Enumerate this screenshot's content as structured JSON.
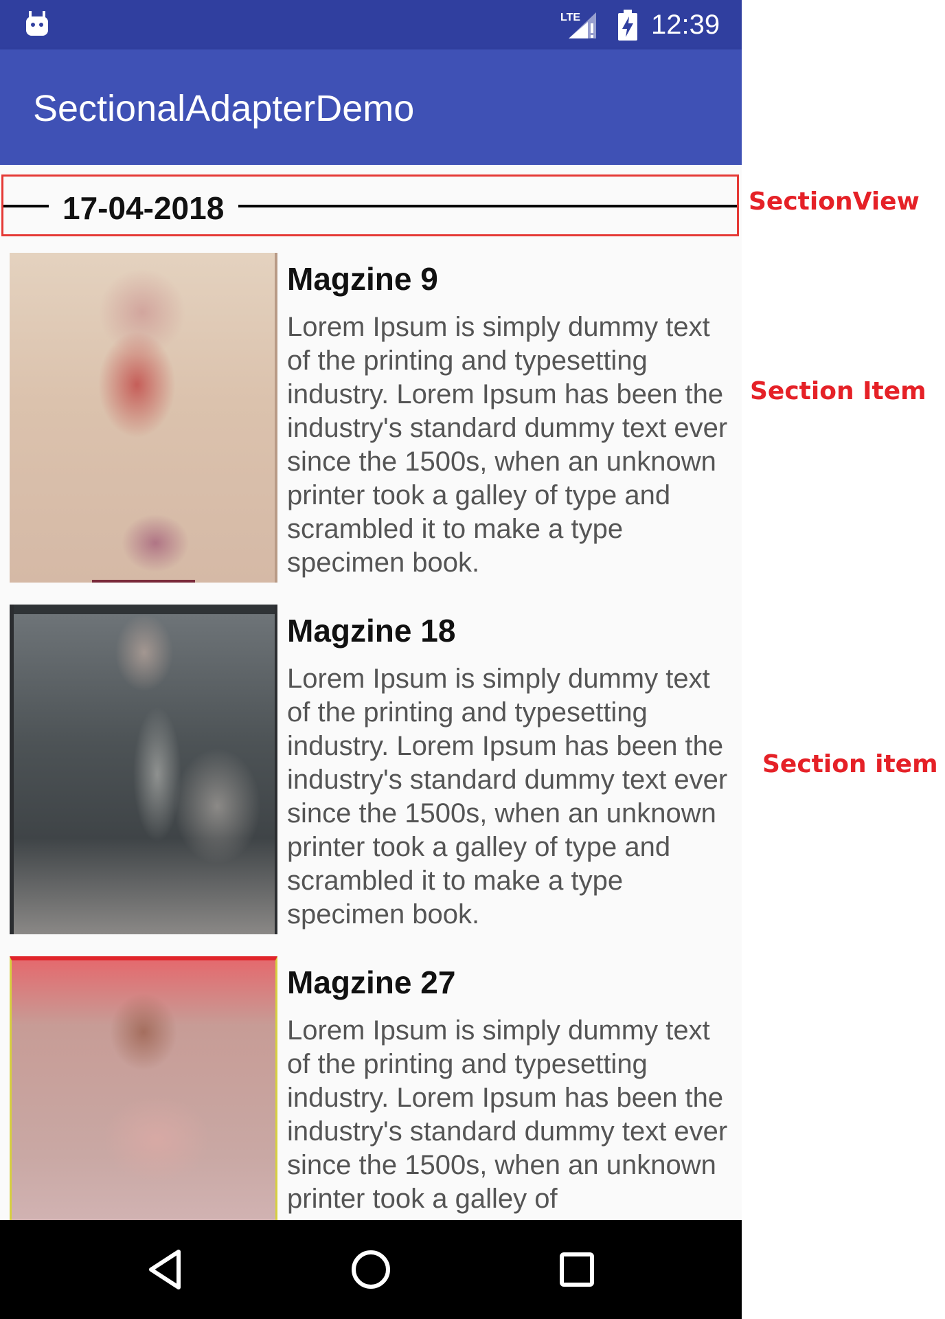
{
  "status_bar": {
    "time": "12:39",
    "network_label": "LTE",
    "icons": [
      "android-debug-icon",
      "signal-lte-icon",
      "battery-charging-icon"
    ]
  },
  "app_bar": {
    "title": "SectionalAdapterDemo",
    "color": "#3f51b5",
    "status_color": "#303f9f"
  },
  "section": {
    "date": "17-04-2018"
  },
  "items": [
    {
      "title": "Magzine 9",
      "description": "Lorem Ipsum is simply dummy text of the printing and typesetting industry. Lorem Ipsum has been the industry's standard dummy text ever since the 1500s, when an unknown printer took a galley of type and scrambled it to make a type specimen book."
    },
    {
      "title": "Magzine 18",
      "description": "Lorem Ipsum is simply dummy text of the printing and typesetting industry. Lorem Ipsum has been the industry's standard dummy text ever since the 1500s, when an unknown printer took a galley of type and scrambled it to make a type specimen book."
    },
    {
      "title": "Magzine 27",
      "description": "Lorem Ipsum is simply dummy text of the printing and typesetting industry. Lorem Ipsum has been the industry's standard dummy text ever since the 1500s, when an unknown printer took a galley of"
    }
  ],
  "annotations": {
    "section_view": "SectionView",
    "section_item_1": "Section Item",
    "section_item_2": "Section item",
    "color": "#e52127"
  },
  "nav_bar": {
    "icons": [
      "back-icon",
      "home-icon",
      "recents-icon"
    ]
  }
}
